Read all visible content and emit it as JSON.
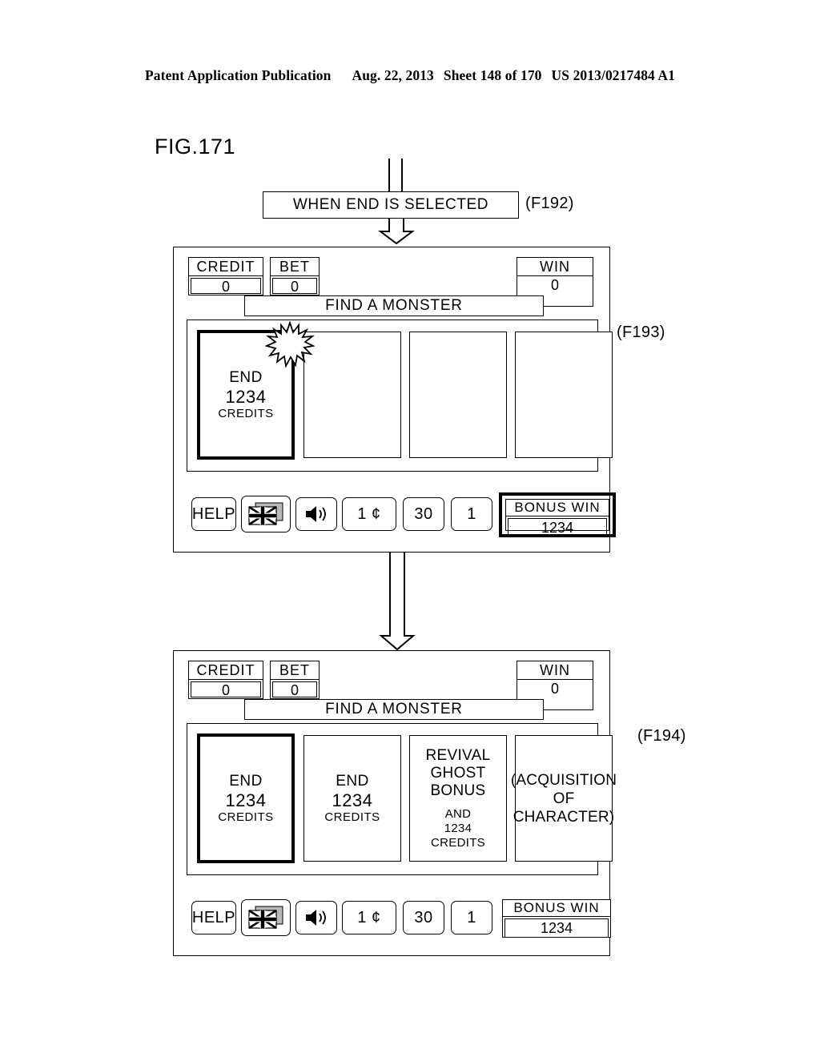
{
  "page_header": {
    "publication": "Patent Application Publication",
    "date": "Aug. 22, 2013",
    "sheet": "Sheet 148 of 170",
    "doc_number": "US 2013/0217484 A1"
  },
  "figure": {
    "label": "FIG.171"
  },
  "condition_step": {
    "text": "WHEN END IS SELECTED",
    "ref": "(F192)"
  },
  "screens": [
    {
      "ref": "(F193)",
      "meters": {
        "credit_label": "CREDIT",
        "credit_value": "0",
        "bet_label": "BET",
        "bet_value": "0",
        "win_label": "WIN",
        "win_value": "0"
      },
      "title_banner": "FIND A MONSTER",
      "cards": [
        {
          "selected": true,
          "lines": [
            "END",
            "1234",
            "CREDITS"
          ],
          "sizes": [
            "l1",
            "l2",
            "l3"
          ],
          "sparkle": true
        },
        {
          "selected": false,
          "lines": [],
          "sizes": [],
          "sparkle": false
        },
        {
          "selected": false,
          "lines": [],
          "sizes": [],
          "sparkle": false
        },
        {
          "selected": false,
          "lines": [],
          "sizes": [],
          "sparkle": false
        }
      ],
      "toolbar": {
        "help_label": "HELP",
        "flag_icon": "uk-flag-icon",
        "sound_icon": "speaker-icon",
        "denom_label": "1 ¢",
        "lines_label": "30",
        "bet_label": "1"
      },
      "bonus": {
        "label": "BONUS WIN",
        "value": "1234",
        "highlighted": true
      }
    },
    {
      "ref": "(F194)",
      "meters": {
        "credit_label": "CREDIT",
        "credit_value": "0",
        "bet_label": "BET",
        "bet_value": "0",
        "win_label": "WIN",
        "win_value": "0"
      },
      "title_banner": "FIND A MONSTER",
      "cards": [
        {
          "selected": true,
          "lines": [
            "END",
            "1234",
            "CREDITS"
          ],
          "sizes": [
            "l1",
            "l2",
            "l3"
          ],
          "sparkle": false
        },
        {
          "selected": false,
          "lines": [
            "END",
            "1234",
            "CREDITS"
          ],
          "sizes": [
            "l1",
            "l2",
            "l3"
          ],
          "sparkle": false
        },
        {
          "selected": false,
          "lines": [
            "REVIVAL",
            "GHOST",
            "BONUS",
            "",
            "AND",
            "1234",
            "CREDITS"
          ],
          "sizes": [
            "big",
            "big",
            "big",
            "spacer",
            "sm",
            "sm",
            "sm"
          ],
          "sparkle": false
        },
        {
          "selected": false,
          "lines": [
            "(ACQUISITION",
            "OF",
            "CHARACTER)"
          ],
          "sizes": [
            "med",
            "med",
            "med"
          ],
          "sparkle": false
        }
      ],
      "toolbar": {
        "help_label": "HELP",
        "flag_icon": "uk-flag-icon",
        "sound_icon": "speaker-icon",
        "denom_label": "1 ¢",
        "lines_label": "30",
        "bet_label": "1"
      },
      "bonus": {
        "label": "BONUS WIN",
        "value": "1234",
        "highlighted": false
      }
    }
  ]
}
